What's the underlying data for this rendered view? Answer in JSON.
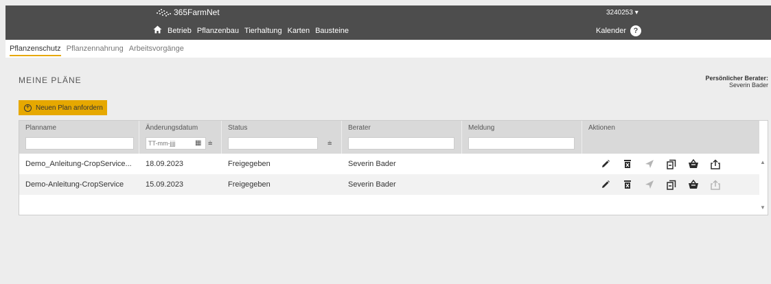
{
  "header": {
    "brand": "365FarmNet",
    "user": "3240253 ▾",
    "nav": [
      "Betrieb",
      "Pflanzenbau",
      "Tierhaltung",
      "Karten",
      "Bausteine"
    ],
    "calendar": "Kalender",
    "help": "?"
  },
  "subtabs": [
    "Pflanzenschutz",
    "Pflanzennahrung",
    "Arbeitsvorgänge"
  ],
  "page": {
    "title": "MEINE PLÄNE",
    "advisor_label": "Persönlicher Berater:",
    "advisor_name": "Severin Bader",
    "new_button": "Neuen Plan anfordern"
  },
  "table": {
    "columns": [
      "Planname",
      "Änderungsdatum",
      "Status",
      "Berater",
      "Meldung",
      "Aktionen"
    ],
    "date_placeholder": "TT-mm-jjjj",
    "rows": [
      {
        "name": "Demo_Anleitung-CropService...",
        "date": "18.09.2023",
        "status": "Freigegeben",
        "advisor": "Severin Bader",
        "message": ""
      },
      {
        "name": "Demo-Anleitung-CropService",
        "date": "15.09.2023",
        "status": "Freigegeben",
        "advisor": "Severin Bader",
        "message": ""
      }
    ],
    "action_icons": [
      "edit-icon",
      "delete-icon",
      "send-icon",
      "copy-icon",
      "basket-icon",
      "export-icon"
    ]
  },
  "colors": {
    "accent": "#e6a800",
    "topbar": "#4d4d4d",
    "icon_dark": "#2b2b2b",
    "icon_muted": "#b5b5b5"
  }
}
